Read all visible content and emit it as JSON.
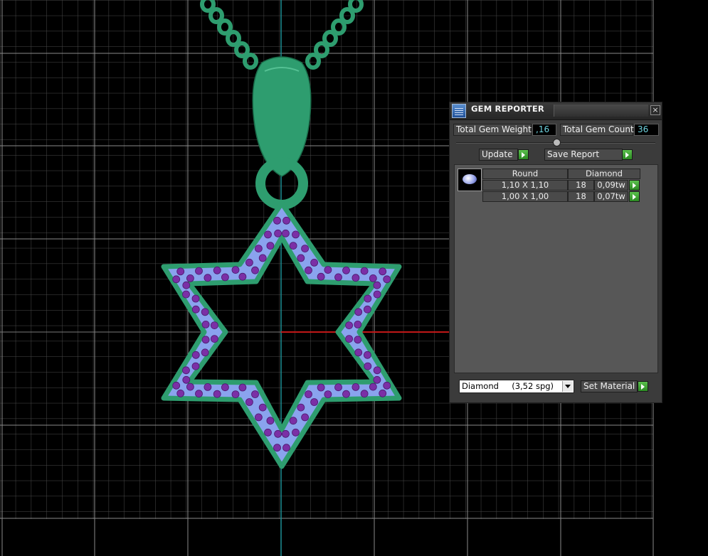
{
  "panel": {
    "title": "GEM REPORTER",
    "close_icon": "close-icon",
    "total_weight_label": "Total Gem Weight",
    "total_weight_value": ",16",
    "total_count_label": "Total Gem Count",
    "total_count_value": "36",
    "update_label": "Update",
    "save_report_label": "Save Report",
    "columns": {
      "shape": "Round",
      "material": "Diamond"
    },
    "rows": [
      {
        "size": "1,10 X 1,10",
        "count": "18",
        "weight": "0,09tw"
      },
      {
        "size": "1,00 X 1,00",
        "count": "18",
        "weight": "0,07tw"
      }
    ],
    "material_select": "Diamond     (3,52 spg)",
    "set_material_label": "Set Material"
  },
  "colors": {
    "metal": "#2e9d6f",
    "pave_surface": "#8aa3ee",
    "gem": "#7b2fa6",
    "grid": "#7a7a7a",
    "axis_vertical": "#1d8f95",
    "axis_horizontal": "#c01818",
    "value_text": "#6fd3df",
    "go_button": "#3aa52e"
  }
}
